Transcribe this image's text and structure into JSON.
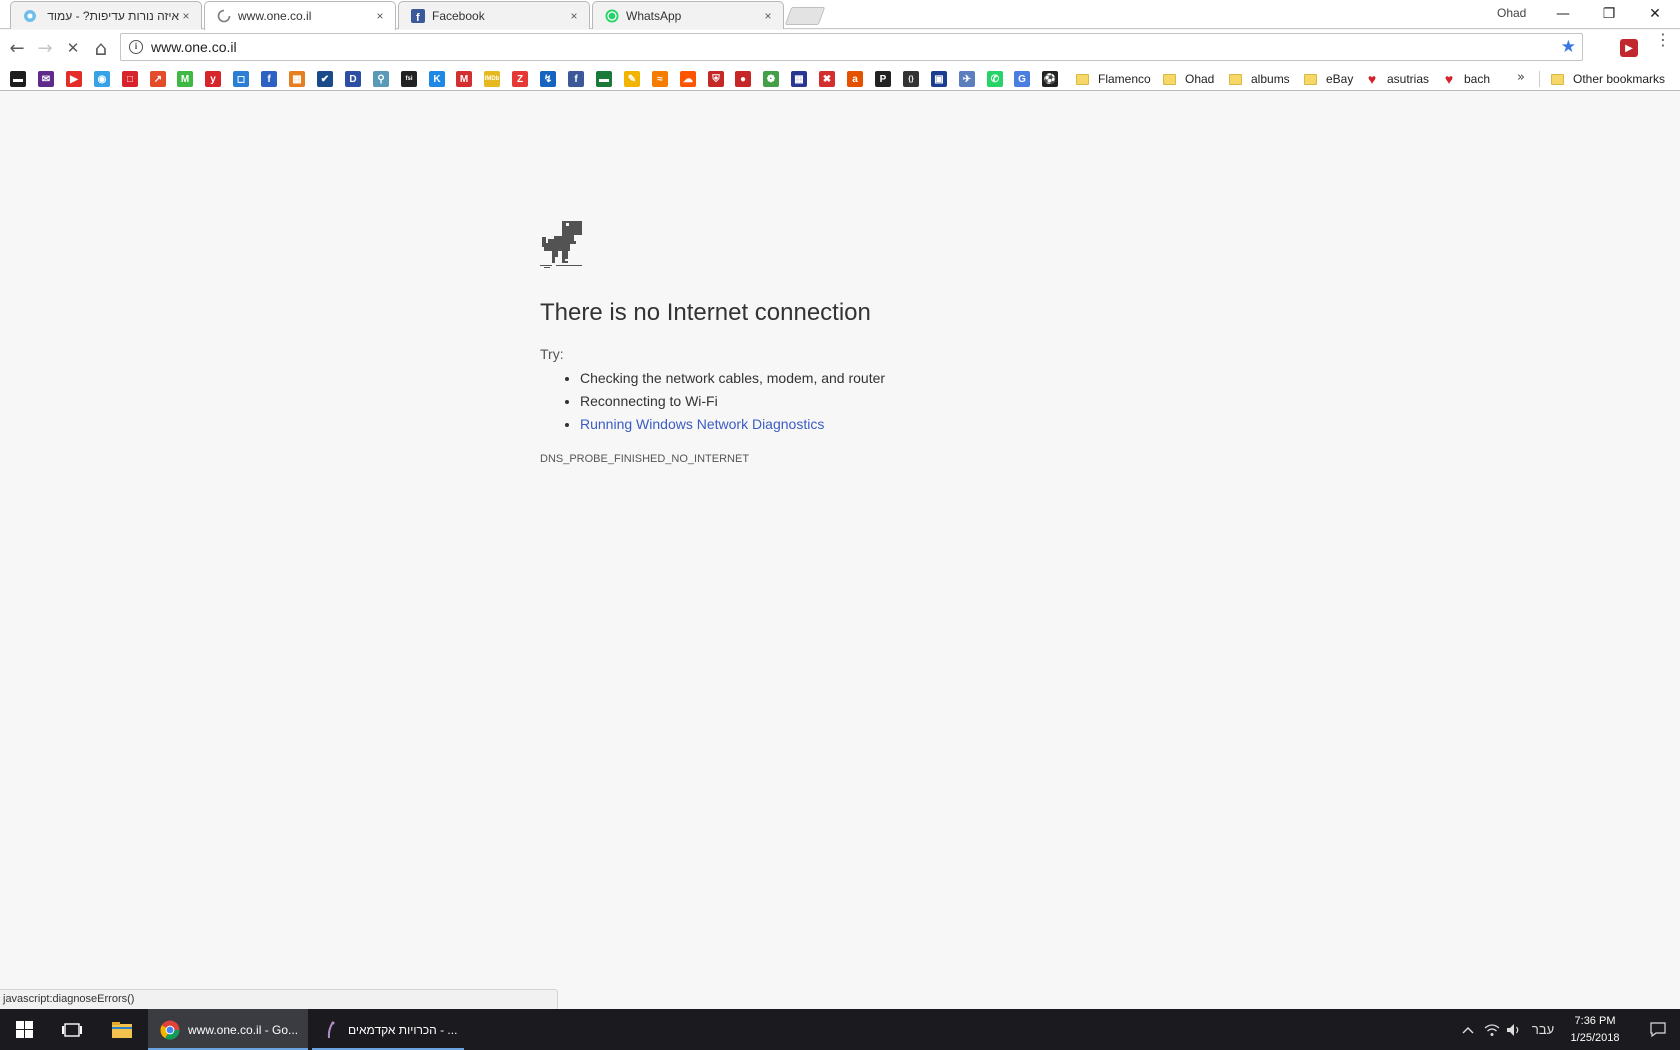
{
  "browser": {
    "tabs": [
      {
        "title": "איזה נורות עדיפות? - עמוד",
        "favicon": "cyan-circle-icon",
        "close": "×"
      },
      {
        "title": "www.one.co.il",
        "favicon": "loading-spinner-icon",
        "close": "×"
      },
      {
        "title": "Facebook",
        "favicon": "facebook-icon",
        "close": "×"
      },
      {
        "title": "WhatsApp",
        "favicon": "whatsapp-icon",
        "close": "×"
      }
    ],
    "profile_name": "Ohad",
    "window_controls": {
      "minimize": "—",
      "restore": "❐",
      "close": "✕"
    },
    "nav": {
      "back": "←",
      "forward": "→",
      "stop": "✕",
      "home": "⌂"
    },
    "address_bar": {
      "url": "www.one.co.il",
      "info_glyph": "i",
      "star_glyph": "★",
      "star_color": "#3a78e0"
    },
    "menu_glyph": "⋮",
    "bookmarks": {
      "icon_only": [
        {
          "name": "bag-bookmark-icon",
          "glyph": "▬",
          "color": "#1e1e1e"
        },
        {
          "name": "mail-bookmark-icon",
          "glyph": "✉",
          "color": "#5e2a8c"
        },
        {
          "name": "youtube-bookmark-icon",
          "glyph": "▶",
          "color": "#e52d27"
        },
        {
          "name": "circle-bookmark-icon",
          "glyph": "◉",
          "color": "#36a3e8"
        },
        {
          "name": "red-square-bookmark-icon",
          "glyph": "□",
          "color": "#d8232a"
        },
        {
          "name": "red-arrow-bookmark-icon",
          "glyph": "↗",
          "color": "#e34b2a"
        },
        {
          "name": "green-m-bookmark-icon",
          "glyph": "M",
          "color": "#3fb845"
        },
        {
          "name": "y-bookmark-icon",
          "glyph": "y",
          "color": "#d6262c"
        },
        {
          "name": "blue-box-bookmark-icon",
          "glyph": "◻",
          "color": "#2a7fd4"
        },
        {
          "name": "blue-f-bookmark-icon",
          "glyph": "f",
          "color": "#2c62c4"
        },
        {
          "name": "orange-grid-bookmark-icon",
          "glyph": "▦",
          "color": "#e67e22"
        },
        {
          "name": "check-bookmark-icon",
          "glyph": "✔",
          "color": "#1a4a8a"
        },
        {
          "name": "blue-d-bookmark-icon",
          "glyph": "D",
          "color": "#2c4fa3"
        },
        {
          "name": "figure-bookmark-icon",
          "glyph": "⚲",
          "color": "#5a9ab8"
        },
        {
          "name": "fsi-bookmark-icon",
          "glyph": "fsi",
          "color": "#222222"
        },
        {
          "name": "k-bookmark-icon",
          "glyph": "K",
          "color": "#1e88e5"
        },
        {
          "name": "m-bookmark-icon",
          "glyph": "M",
          "color": "#d32f2f"
        },
        {
          "name": "imdb-bookmark-icon",
          "glyph": "IMDb",
          "color": "#e6b91e"
        },
        {
          "name": "z-bookmark-icon",
          "glyph": "Z",
          "color": "#e53935"
        },
        {
          "name": "chart-bookmark-icon",
          "glyph": "↯",
          "color": "#1565c0"
        },
        {
          "name": "facebook-bookmark-icon",
          "glyph": "f",
          "color": "#3b5998"
        },
        {
          "name": "green-bar-bookmark-icon",
          "glyph": "▬",
          "color": "#1b7a3a"
        },
        {
          "name": "yellow-bookmark-icon",
          "glyph": "✎",
          "color": "#f2b400"
        },
        {
          "name": "orange-wave-bookmark-icon",
          "glyph": "≈",
          "color": "#f57c00"
        },
        {
          "name": "soundcloud-bookmark-icon",
          "glyph": "☁",
          "color": "#ff5500"
        },
        {
          "name": "shield-bookmark-icon",
          "glyph": "⛨",
          "color": "#c62828"
        },
        {
          "name": "red-ball-bookmark-icon",
          "glyph": "●",
          "color": "#c62828"
        },
        {
          "name": "green-swirl-bookmark-icon",
          "glyph": "❁",
          "color": "#43a047"
        },
        {
          "name": "calendar-bookmark-icon",
          "glyph": "▦",
          "color": "#283593"
        },
        {
          "name": "red-x-bookmark-icon",
          "glyph": "✖",
          "color": "#d32f2f"
        },
        {
          "name": "orange-circle-bookmark-icon",
          "glyph": "a",
          "color": "#e65100"
        },
        {
          "name": "p-bookmark-icon",
          "glyph": "P",
          "color": "#222222"
        },
        {
          "name": "bracket-bookmark-icon",
          "glyph": "{}",
          "color": "#333333"
        },
        {
          "name": "frame-bookmark-icon",
          "glyph": "▣",
          "color": "#1a3d8f"
        },
        {
          "name": "bird-bookmark-icon",
          "glyph": "✈",
          "color": "#5b7fbd"
        },
        {
          "name": "whatsapp-bookmark-icon",
          "glyph": "✆",
          "color": "#25d366"
        },
        {
          "name": "translate-bookmark-icon",
          "glyph": "G",
          "color": "#4a7fe0"
        },
        {
          "name": "football-bookmark-icon",
          "glyph": "⚽",
          "color": "#222222"
        }
      ],
      "folders": [
        {
          "label": "Flamenco",
          "type": "folder"
        },
        {
          "label": "Ohad",
          "type": "folder"
        },
        {
          "label": "albums",
          "type": "folder"
        },
        {
          "label": "eBay",
          "type": "folder"
        },
        {
          "label": "asutrias",
          "type": "heart"
        },
        {
          "label": "bach",
          "type": "heart"
        }
      ],
      "overflow": "»",
      "other": "Other bookmarks"
    }
  },
  "error_page": {
    "title": "There is no Internet connection",
    "try_label": "Try:",
    "suggestions": [
      "Checking the network cables, modem, and router",
      "Reconnecting to Wi-Fi"
    ],
    "diagnostics_link": "Running Windows Network Diagnostics",
    "error_code": "DNS_PROBE_FINISHED_NO_INTERNET",
    "link_color": "#3b5cc4"
  },
  "status_bar": "javascript:diagnoseErrors()",
  "taskbar": {
    "apps": [
      {
        "label": "www.one.co.il - Go...",
        "icon": "chrome-icon"
      },
      {
        "label": "הכרויות אקדמאים - ...",
        "icon": "dating-app-icon"
      }
    ],
    "language": "עבר",
    "time": "7:36 PM",
    "date": "1/25/2018"
  }
}
